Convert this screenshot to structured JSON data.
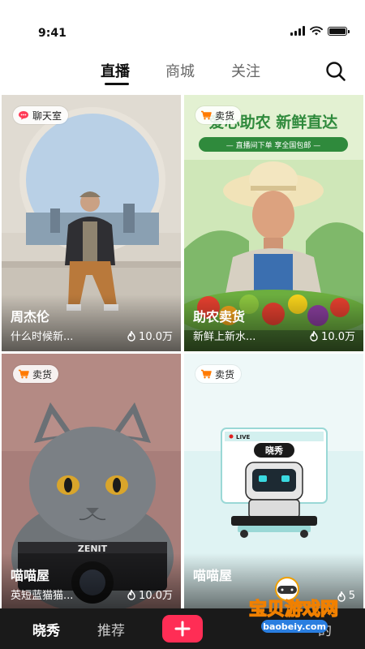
{
  "status_bar": {
    "time": "9:41"
  },
  "tabs": [
    {
      "label": "直播",
      "active": true
    },
    {
      "label": "商城",
      "active": false
    },
    {
      "label": "关注",
      "active": false
    }
  ],
  "search": {
    "icon": "search-icon"
  },
  "cards": [
    {
      "tag": "聊天室",
      "tag_icon": "chat-bubble-icon",
      "name": "周杰伦",
      "desc": "什么时候新...",
      "views": "10.0万"
    },
    {
      "tag": "卖货",
      "tag_icon": "shopping-cart-icon",
      "name": "助农卖货",
      "desc": "新鲜上新水...",
      "views": "10.0万",
      "banner_title": "爱心助农 新鲜直达",
      "banner_subtitle": "— 直播间下单   享全国包邮 —"
    },
    {
      "tag": "卖货",
      "tag_icon": "shopping-cart-icon",
      "name": "喵喵屋",
      "desc": "英短蓝猫猫...",
      "views": "10.0万",
      "camera_brand": "ZENIT"
    },
    {
      "tag": "卖货",
      "tag_icon": "shopping-cart-icon",
      "name": "喵喵屋",
      "desc": "",
      "views": "5",
      "live_badge": "LIVE",
      "robot_label": "晓秀"
    }
  ],
  "bottom_nav": {
    "items": [
      {
        "label": "晓秀",
        "active": true
      },
      {
        "label": "推荐",
        "active": false
      }
    ],
    "plus_label": "+",
    "right_partial": "的"
  },
  "watermark": {
    "title": "宝贝游戏网",
    "url": "baobeiy.com"
  },
  "colors": {
    "accent": "#ff2d55",
    "nav_bg": "#1a1a1a",
    "farm_green": "#2f8a3c",
    "cat_bg": "#a87e7a",
    "robot_bg": "#dff3f3"
  }
}
